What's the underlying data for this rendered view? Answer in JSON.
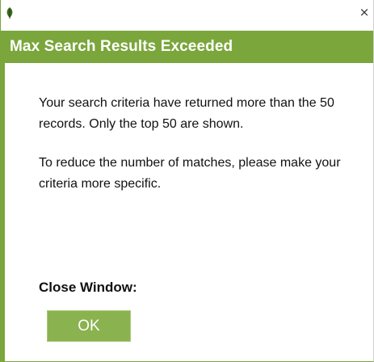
{
  "window": {
    "close_glyph": "×",
    "icon": "app-leaf-icon",
    "accent_color": "#7aa63c"
  },
  "dialog": {
    "title": "Max Search Results Exceeded",
    "message_line1": "Your search criteria have returned more than the 50 records. Only the top 50 are shown.",
    "message_line2": "To reduce the number of matches, please make your criteria more specific.",
    "close_label": "Close Window:",
    "ok_button_label": "OK",
    "button_color": "#8ab24f"
  }
}
